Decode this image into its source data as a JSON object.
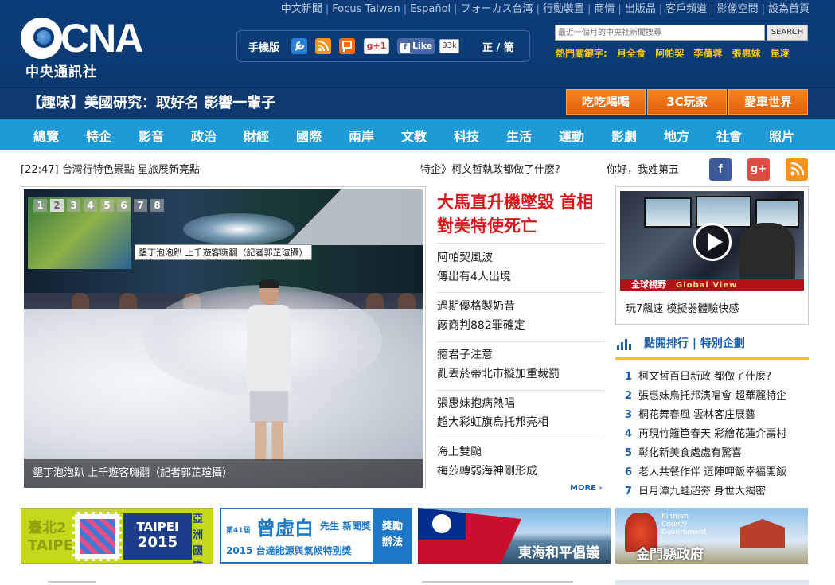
{
  "toplinks": [
    "中文新聞",
    "Focus Taiwan",
    "Español",
    "フォーカス台湾",
    "行動裝置",
    "商情",
    "出版品",
    "客戶頻道",
    "影像空間",
    "設為首頁"
  ],
  "logo": {
    "letters": "CNA",
    "name": "中央通訊社"
  },
  "toolbox": {
    "mobile_label": "手機版",
    "gplus_label": "g+1",
    "fb_label": "Like",
    "fb_count": "93k",
    "lang_toggle": "正 / 簡"
  },
  "search": {
    "placeholder": "最近一個月的中央社新聞搜尋",
    "button": "SEARCH"
  },
  "hot": {
    "label": "熱門關鍵字:",
    "keywords": [
      "月全食",
      "阿帕契",
      "李蒨蓉",
      "張惠妹",
      "昆凌"
    ]
  },
  "banner": {
    "title": "【趣味】美國研究：取好名 影響一輩子",
    "buttons": [
      "吃吃喝喝",
      "3C玩家",
      "愛車世界"
    ]
  },
  "nav": [
    "總覽",
    "特企",
    "影音",
    "政治",
    "財經",
    "國際",
    "兩岸",
    "文教",
    "科技",
    "生活",
    "運動",
    "影劇",
    "地方",
    "社會",
    "照片"
  ],
  "ticker": {
    "time": "[22:47] 台灣行特色景點 星旅展新亮點",
    "special": "特企》柯文哲執政都做了什麼?",
    "hello": "你好，我姓第五"
  },
  "social": {
    "fb": "f",
    "gplus": "g+",
    "rss": "rss"
  },
  "slideshow": {
    "dots": [
      "1",
      "2",
      "3",
      "4",
      "5",
      "6",
      "7",
      "8"
    ],
    "active": 2,
    "tooltip": "墾丁泡泡趴 上千遊客嗨翻（記者郭芷瑄攝）",
    "caption": "墾丁泡泡趴 上千遊客嗨翻（記者郭芷瑄攝）"
  },
  "headline": "大馬直升機墜毀 首相對美特使死亡",
  "news": [
    {
      "line1": "阿帕契風波",
      "line2": "傳出有4人出境"
    },
    {
      "line1": "過期優格製奶昔",
      "line2": "廠商判882罪確定"
    },
    {
      "line1": "瘾君子注意",
      "line2": "亂丟菸蒂北市擬加重裁罰"
    },
    {
      "line1": "張惠妹抱病熱唱",
      "line2": "超大彩虹旗烏托邦亮相"
    },
    {
      "line1": "海上雙颱",
      "line2": "梅莎轉弱海神剛形成"
    }
  ],
  "more": "MORE ›",
  "video": {
    "caption": "玩7飆速 模擬器體驗快感",
    "brand_cn": "全球視野",
    "brand_en": "Global View"
  },
  "ranking": {
    "title": "點閱排行 | 特別企劃",
    "items": [
      "柯文哲百日新政 都做了什麼?",
      "張惠妹烏托邦演唱會 超華麗特企",
      "桐花舞春風 雲林客庄展藝",
      "再現竹籬笆春天 彩繪花蓮介壽村",
      "彰化新美食處處有驚喜",
      "老人共餐作伴 逗陣呷飯幸福開飯",
      "日月潭九蛙超夯 身世大揭密"
    ]
  },
  "ads": {
    "ad1": {
      "left": "臺北2",
      "left2": "TAIPE",
      "mid1": "TAIPEI",
      "mid2": "2015",
      "right": "亞洲\n國際\n郵展"
    },
    "ad2": {
      "line1": "第41屆",
      "name": "曾虛白",
      "sub": "先生 新聞獎",
      "line2": "2015 台達能源與氣候特別獎",
      "badge1": "獎勵",
      "badge2": "辦法"
    },
    "ad3": {
      "text": "東海和平倡議"
    },
    "ad4": {
      "en1": "Kinmen",
      "en2": "County",
      "en3": "Government",
      "text": "金門縣政府"
    }
  },
  "colors": {
    "header": "#0c3d7a",
    "nav": "#1e9ad6",
    "headline": "#d9161b",
    "link": "#1a5fa8",
    "orange": "#f07316",
    "hot": "#f4c21a"
  }
}
